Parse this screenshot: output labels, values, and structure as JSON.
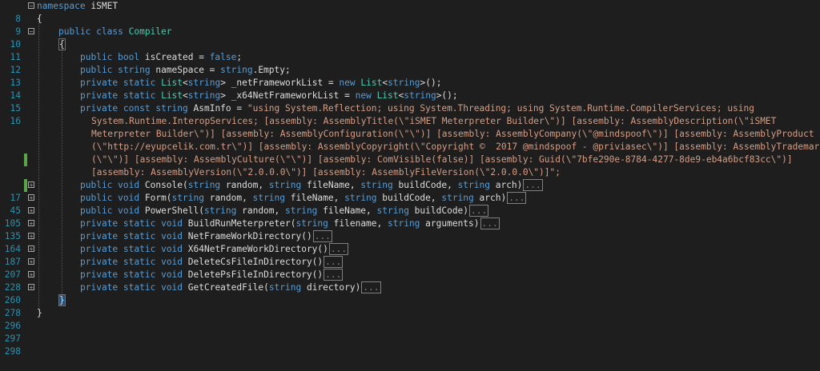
{
  "editor": {
    "lines": {
      "l8": "8",
      "l9": "9",
      "l10": "10",
      "l11": "11",
      "l12": "12",
      "l13": "13",
      "l14": "14",
      "l15": "15",
      "l16": "16",
      "l17": "17",
      "l45": "45",
      "l105": "105",
      "l135": "135",
      "l164": "164",
      "l187": "187",
      "l207": "207",
      "l228": "228",
      "l260": "260",
      "l278": "278",
      "l296": "296",
      "l297": "297",
      "l298": "298"
    },
    "tokens": {
      "ns_kw": "namespace",
      "ns_name": "iSMET",
      "open_brace": "{",
      "close_brace": "}",
      "public": "public",
      "private": "private",
      "static": "static",
      "const": "const",
      "class": "class",
      "void": "void",
      "bool": "bool",
      "string": "string",
      "new": "new",
      "false": "false",
      "class_name": "Compiler",
      "list": "List",
      "collapsed": "...",
      "l12_rest": " isCreated = ",
      "l12_end": ";",
      "l13_rest": " nameSpace = ",
      "l13_end": ".Empty;",
      "l14_var": "> _netFrameworkList = ",
      "l14_end": ">();",
      "l15_var": "> _x64NetFrameworkList = ",
      "l15_end": ">();",
      "l16_name": " AsmInfo = ",
      "asm_1": "\"using System.Reflection; using System.Threading; using System.Runtime.CompilerServices; using",
      "asm_2": "System.Runtime.InteropServices; [assembly: AssemblyTitle(\\\"iSMET Meterpreter Builder\\\")] [assembly: AssemblyDescription(\\\"iSMET",
      "asm_3": "Meterpreter Builder\\\")] [assembly: AssemblyConfiguration(\\\"\\\")] [assembly: AssemblyCompany(\\\"@mindspoof\\\")] [assembly: AssemblyProduct",
      "asm_4": "(\\\"http://eyupcelik.com.tr\\\")] [assembly: AssemblyCopyright(\\\"Copyright ©  2017 @mindspoof - @priviasec\\\")] [assembly: AssemblyTrademark",
      "asm_5": "(\\\"\\\")] [assembly: AssemblyCulture(\\\"\\\")] [assembly: ComVisible(false)] [assembly: Guid(\\\"7bfe290e-8784-4277-8de9-eb4a6bcf83cc\\\")]",
      "asm_6": "[assembly: AssemblyVersion(\\\"2.0.0.0\\\")] [assembly: AssemblyFileVersion(\\\"2.0.0.0\\\")]\";",
      "m_console": " Console(",
      "m_form": " Form(",
      "m_powershell": " PowerShell(",
      "m_buildrun": " BuildRunMeterpreter(",
      "m_netdir": " NetFrameWorkDirectory()",
      "m_x64dir": " X64NetFrameWorkDirectory()",
      "m_delcs": " DeleteCsFileInDirectory()",
      "m_delps": " DeletePsFileInDirectory()",
      "m_getfile": " GetCreatedFile(",
      "p_random": " random, ",
      "p_filename": " fileName, ",
      "p_filename_low": " filename, ",
      "p_buildcode_c": " buildCode, ",
      "p_buildcode_end": " buildCode)",
      "p_arch": " arch)",
      "p_arguments": " arguments)",
      "p_directory": " directory)"
    }
  }
}
